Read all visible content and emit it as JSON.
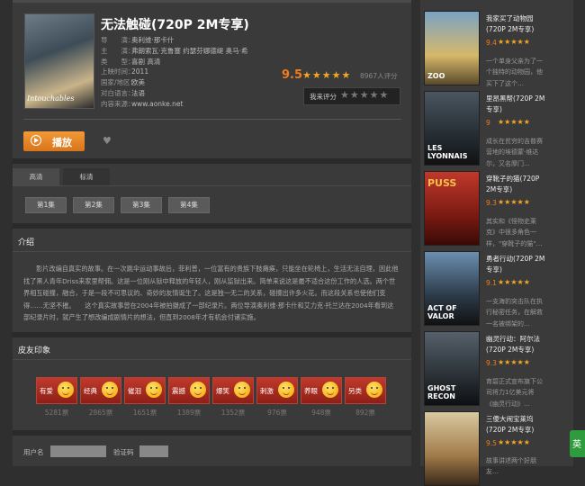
{
  "movie": {
    "poster_text": "Intouchables",
    "title": "无法触碰(720P 2M专享)",
    "info": [
      {
        "key": "导　　演：",
        "value": "奥利维·那卡什"
      },
      {
        "key": "主　　演：",
        "value": "弗朗索瓦·克鲁塞 约瑟芬娜德缇 奥马·希"
      },
      {
        "key": "类　　型：",
        "value": "喜剧 高清"
      },
      {
        "key": "上映时间：",
        "value": "2011"
      },
      {
        "key": "国家/地区：",
        "value": "欧美"
      },
      {
        "key": "对白语言：",
        "value": "法语"
      },
      {
        "key": "内容来源：",
        "value": "www.aonke.net"
      }
    ],
    "rating": "9.5",
    "stars": "★★★★★",
    "votes": "8967人评分",
    "my_rate_label": "我来评分",
    "my_rate_stars": "★★★★★",
    "play_label": "播放",
    "heart": "♥"
  },
  "tabs": [
    "高清",
    "标清"
  ],
  "episodes": [
    "第1集",
    "第2集",
    "第3集",
    "第4集"
  ],
  "intro": {
    "title": "介绍",
    "text": "影片改编自真实的故事。在一次跳伞运动事故后，菲利普，一位富有的贵族下肢瘫痪，只能坐在轮椅上，生活无法自理，因此他找了黑人青年Driss来家里帮佣。这是一位刚从狱中释放的年轻人，刚从监狱出来。简单来说这是最不适合这份工作的人选。两个世界相互碰撞，融合，于是一段不可思议的、奇妙的友情诞生了。这是独一无二的关系，碰撞出许多火花。而这段关系也使他们变得……无坚不摧。　　这个真实故事曾在2004年被拍摄成了一部纪录片。两位导演奥利维·那卡什和艾力克·托兰达在2004年看到这部纪录片时，就产生了想改编成剧情片的想法，但直到2008年才有机会付诸实施。"
  },
  "reactions": {
    "title": "皮友印象",
    "items": [
      {
        "label": "有爱",
        "count": "5281票"
      },
      {
        "label": "经典",
        "count": "2865票"
      },
      {
        "label": "催泪",
        "count": "1651票"
      },
      {
        "label": "震撼",
        "count": "1389票"
      },
      {
        "label": "爆笑",
        "count": "1352票"
      },
      {
        "label": "刺激",
        "count": "976票"
      },
      {
        "label": "养眼",
        "count": "948票"
      },
      {
        "label": "另类",
        "count": "892票"
      }
    ]
  },
  "form": {
    "username_label": "用户名",
    "captcha_label": "验证码"
  },
  "sidebar": [
    {
      "thumb_text": "ZOO",
      "title": "我家买了动物园(720P 2M专享)",
      "rating": "9.4",
      "stars": "★★★★★",
      "desc": "一个单身父亲为了一个独特的动物园，他买下了这个…"
    },
    {
      "thumb_text": "LES LYONNAIS",
      "title": "里昂黑帮(720P 2M专享)",
      "rating": "9",
      "stars": "★★★★★",
      "desc": "成长在贫穷的吉普赛营地的埃德蒙·维达尔，又名摩门…"
    },
    {
      "thumb_text": "PUSS",
      "title": "穿靴子的猫(720P 2M专享)",
      "rating": "9.3",
      "stars": "★★★★★",
      "desc": "其实和《怪物史莱克》中很多角色一样，\"穿靴子的猫\"…"
    },
    {
      "thumb_text": "ACT OF VALOR",
      "title": "勇者行动(720P 2M专享)",
      "rating": "9.1",
      "stars": "★★★★★",
      "desc": "一支海豹突击队在执行秘密任务，在解救一名被绑架的…"
    },
    {
      "thumb_text": "GHOST RECON",
      "title": "幽灵行动：阿尔法(720P 2M专享)",
      "rating": "9.3",
      "stars": "★★★★★",
      "desc": "育碧正式宣布旗下公司将力1亿美元将《幽灵行动》…"
    },
    {
      "thumb_text": "",
      "title": "三傻大闹宝莱坞(720P 2M专享)",
      "rating": "9.5",
      "stars": "★★★★★",
      "desc": "故事讲述两个好朋友…"
    }
  ],
  "float_button": "英"
}
